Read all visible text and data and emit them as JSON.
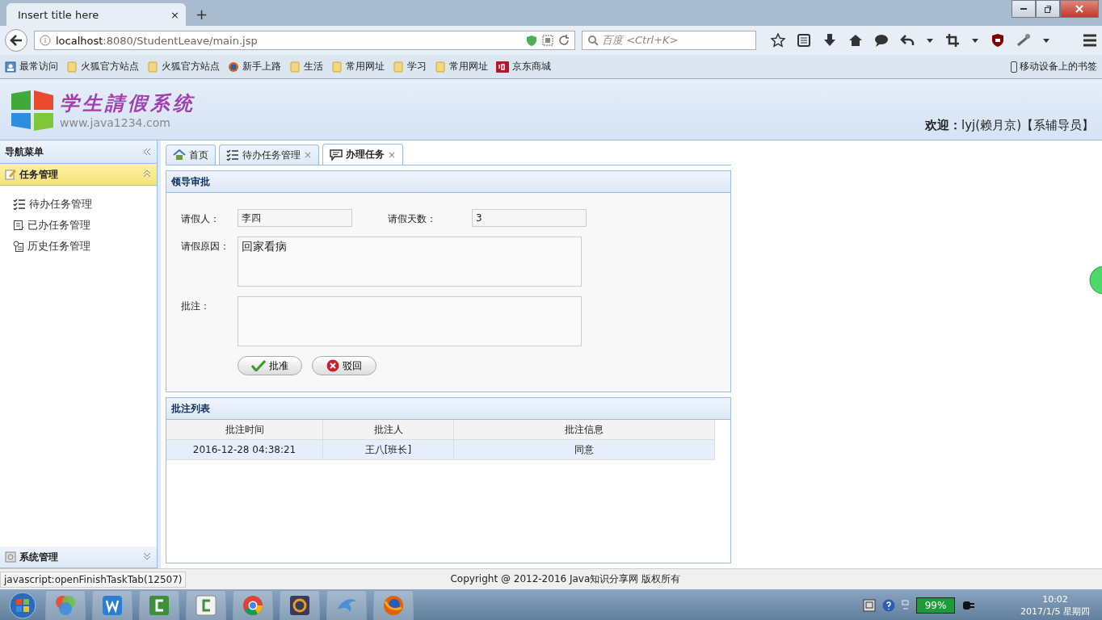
{
  "browser": {
    "tabs": [
      {
        "title": "Insert title here",
        "close": "×",
        "selected": true
      }
    ],
    "new_tab": "+",
    "url_host": "localhost",
    "url_path": ":8080/StudentLeave/main.jsp",
    "search_placeholder": "百度 <Ctrl+K>",
    "bookmarks": [
      {
        "label": "最常访问",
        "kind": "frequent"
      },
      {
        "label": "火狐官方站点",
        "kind": "folder"
      },
      {
        "label": "火狐官方站点",
        "kind": "folder"
      },
      {
        "label": "新手上路",
        "kind": "firefox"
      },
      {
        "label": "生活",
        "kind": "folder"
      },
      {
        "label": "常用网址",
        "kind": "folder"
      },
      {
        "label": "学习",
        "kind": "folder"
      },
      {
        "label": "常用网址",
        "kind": "folder"
      },
      {
        "label": "京东商城",
        "kind": "jd"
      }
    ],
    "mobile_bookmarks": "移动设备上的书签"
  },
  "header": {
    "logo_title": "学生請假系统",
    "logo_url": "www.java1234.com",
    "welcome": "**欢迎：**lyj(赖月京)【系辅导员】"
  },
  "sidebar": {
    "title": "导航菜单",
    "panels": [
      {
        "title": "任务管理",
        "expanded": true,
        "items": [
          {
            "label": "待办任务管理",
            "kind": "todo"
          },
          {
            "label": "已办任务管理",
            "kind": "done"
          },
          {
            "label": "历史任务管理",
            "kind": "history"
          }
        ]
      },
      {
        "title": "系统管理",
        "expanded": false
      }
    ]
  },
  "tabs": [
    {
      "label": "首页",
      "kind": "home",
      "selected": false
    },
    {
      "label": "待办任务管理",
      "kind": "list",
      "close": "×",
      "selected": false
    },
    {
      "label": "办理任务",
      "kind": "task",
      "close": "×",
      "selected": true
    }
  ],
  "form": {
    "title": "领导审批",
    "applicant_label": "请假人：",
    "applicant": "李四",
    "days_label": "请假天数：",
    "days": "3",
    "reason_label": "请假原因：",
    "reason": "回家看病",
    "comment_label": "批注：",
    "buttons": [
      {
        "label": "批准",
        "kind": "approve"
      },
      {
        "label": "驳回",
        "kind": "reject"
      }
    ]
  },
  "comments": {
    "title": "批注列表",
    "columns": [
      "批注时间",
      "批注人",
      "批注信息"
    ],
    "rows": [
      [
        "2016-12-28 04:38:21",
        "王八[班长]",
        "同意"
      ]
    ]
  },
  "status_bar": {
    "link": "javascript:openFinishTaskTab(12507)",
    "copyright": "Copyright @ 2012-2016 Java知识分享网 版权所有"
  },
  "taskbar": {
    "apps": [
      {
        "kind": "photos"
      },
      {
        "kind": "writer"
      },
      {
        "kind": "camtasia"
      },
      {
        "kind": "camtasia-light"
      },
      {
        "kind": "chrome"
      },
      {
        "kind": "ide"
      },
      {
        "kind": "dolphin"
      },
      {
        "kind": "firefox"
      }
    ],
    "battery": "99%",
    "time": "10:02",
    "date": "2017/1/5 星期四"
  }
}
